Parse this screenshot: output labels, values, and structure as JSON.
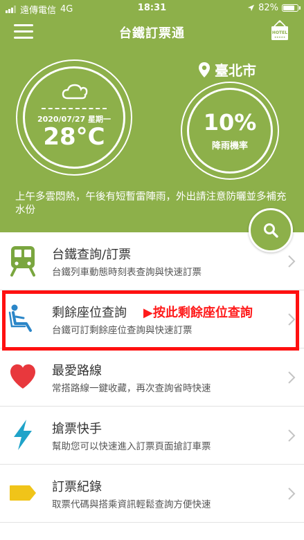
{
  "status_bar": {
    "carrier": "遠傳電信",
    "network": "4G",
    "time": "18:31",
    "battery": "82%",
    "battery_level": 0.82,
    "signal_bars": 3
  },
  "header": {
    "title": "台鐵訂票通",
    "hotel_icon_label": "HOTEL"
  },
  "weather": {
    "date": "2020/07/27 星期一",
    "temperature": "28°C",
    "city": "臺北市",
    "rain_percent": "10%",
    "rain_label": "降雨機率",
    "forecast": "上午多雲悶熱，午後有短暫雷陣雨，外出請注意防曬並多補充水份"
  },
  "menu": [
    {
      "title": "台鐵查詢/訂票",
      "subtitle": "台鐵列車動態時刻表查詢與快速訂票",
      "icon": "train-icon"
    },
    {
      "title": "剩餘座位查詢",
      "subtitle": "台鐵可訂剩餘座位查詢與快速訂票",
      "icon": "seat-icon",
      "note": "▶按此剩餘座位查詢"
    },
    {
      "title": "最愛路線",
      "subtitle": "常搭路線一鍵收藏，再次查詢省時快速",
      "icon": "heart-icon"
    },
    {
      "title": "搶票快手",
      "subtitle": "幫助您可以快速進入訂票頁面搶訂車票",
      "icon": "lightning-icon"
    },
    {
      "title": "訂票紀錄",
      "subtitle": "取票代碼與搭乘資訊輕鬆查詢方便快速",
      "icon": "tag-icon"
    }
  ],
  "colors": {
    "header_green": "#8db04a",
    "train_icon": "#7aa63f",
    "seat_icon": "#2b86c8",
    "heart_icon": "#e8383d",
    "lightning_icon": "#1fa3c9",
    "tag_icon": "#f0c419",
    "highlight": "#ff1010"
  }
}
